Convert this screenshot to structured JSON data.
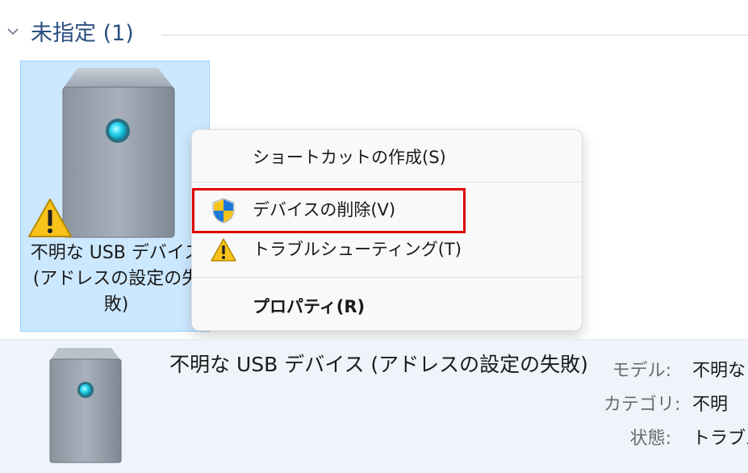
{
  "group": {
    "title": "未指定 (1)"
  },
  "device_tile": {
    "label": "不明な USB デバイス (アドレスの設定の失敗)"
  },
  "context_menu": {
    "items": [
      {
        "label": "ショートカットの作成(S)"
      },
      {
        "label": "デバイスの削除(V)",
        "icon": "uac-shield-icon"
      },
      {
        "label": "トラブルシューティング(T)",
        "icon": "warning-icon"
      },
      {
        "label": "プロパティ(R)"
      }
    ]
  },
  "details": {
    "name": "不明な USB デバイス (アドレスの設定の失敗)",
    "props": [
      {
        "key": "モデル:",
        "value": "不明な"
      },
      {
        "key": "カテゴリ:",
        "value": "不明"
      },
      {
        "key": "状態:",
        "value": "トラブル"
      }
    ]
  },
  "colors": {
    "selection": "#cce8ff",
    "highlight_box": "#e00000",
    "group_title": "#2a4f80"
  }
}
